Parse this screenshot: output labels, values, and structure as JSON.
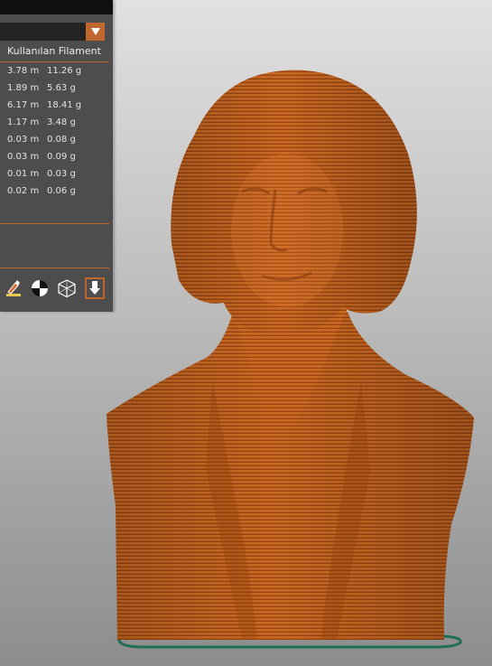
{
  "panel": {
    "section_title": "Kullanılan Filament",
    "rows": [
      {
        "length": "3.78 m",
        "weight": "11.26 g"
      },
      {
        "length": "1.89 m",
        "weight": "5.63 g"
      },
      {
        "length": "6.17 m",
        "weight": "18.41 g"
      },
      {
        "length": "1.17 m",
        "weight": "3.48 g"
      },
      {
        "length": "0.03 m",
        "weight": "0.08 g"
      },
      {
        "length": "0.03 m",
        "weight": "0.09 g"
      },
      {
        "length": "0.01 m",
        "weight": "0.03 g"
      },
      {
        "length": "0.02 m",
        "weight": "0.06 g"
      }
    ],
    "toolbar": {
      "icons": [
        "paint-brush-icon",
        "center-view-icon",
        "wireframe-cube-icon",
        "download-arrow-icon"
      ]
    }
  },
  "colors": {
    "accent": "#c0672d",
    "panel_bg": "#4d4d4d",
    "model": "#c96420",
    "bed_outline": "#1f6e57"
  }
}
